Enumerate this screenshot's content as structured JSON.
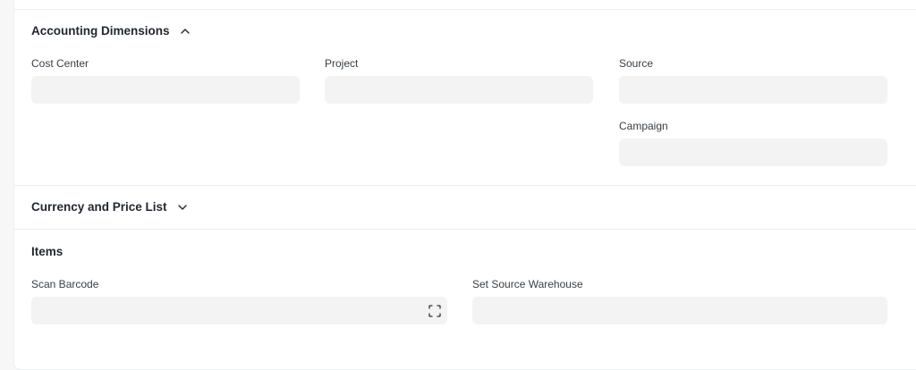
{
  "sections": {
    "accounting": {
      "title": "Accounting Dimensions",
      "state": "expanded",
      "fields": {
        "cost_center": {
          "label": "Cost Center",
          "value": ""
        },
        "project": {
          "label": "Project",
          "value": ""
        },
        "source": {
          "label": "Source",
          "value": ""
        },
        "campaign": {
          "label": "Campaign",
          "value": ""
        }
      }
    },
    "currency": {
      "title": "Currency and Price List",
      "state": "collapsed"
    },
    "items": {
      "title": "Items",
      "fields": {
        "scan_barcode": {
          "label": "Scan Barcode",
          "value": "",
          "icon": "scan-icon"
        },
        "set_source_warehouse": {
          "label": "Set Source Warehouse",
          "value": ""
        }
      }
    }
  },
  "icons": {
    "accounting_toggle": "chevron-up-icon",
    "currency_toggle": "chevron-down-icon"
  },
  "colors": {
    "field_bg": "#f3f3f4",
    "text": "#1f272e",
    "divider": "#edeef0"
  }
}
